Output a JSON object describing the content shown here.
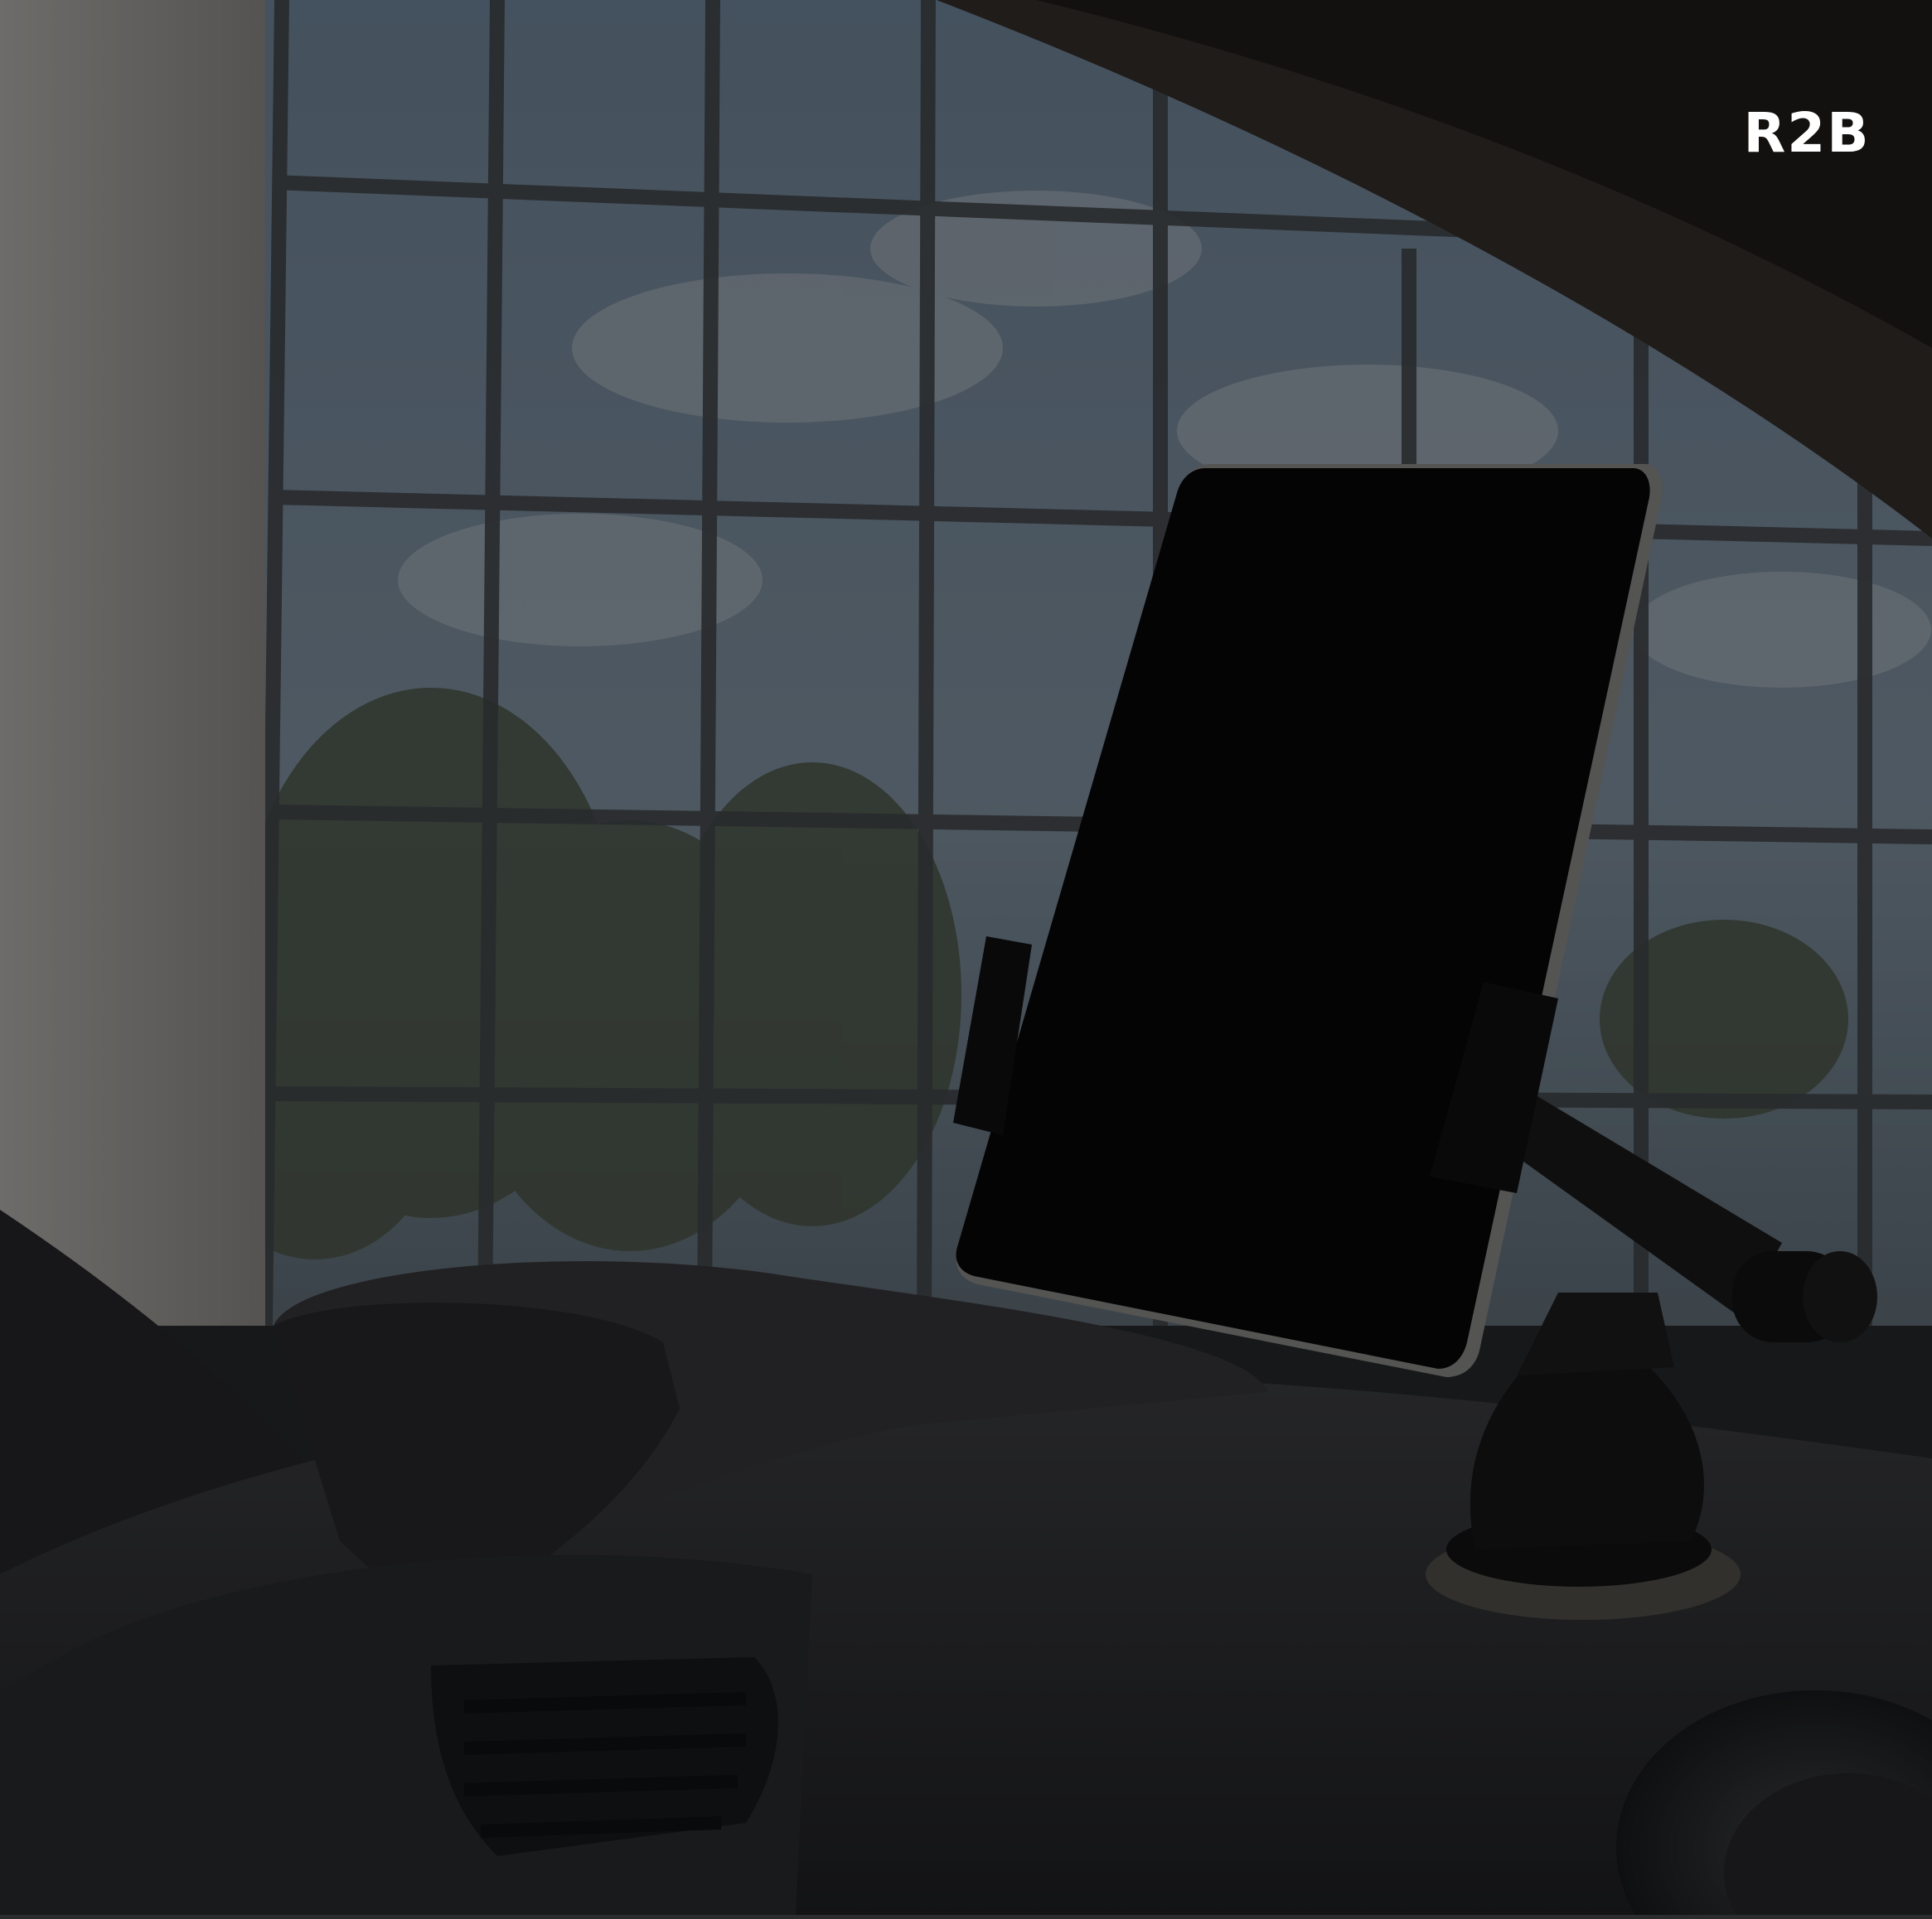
{
  "brand": {
    "logo_text": "R2B"
  },
  "scene": {
    "subject": "tablet-in-car-dashboard-mount",
    "colors": {
      "overlay": "#000000",
      "overlay_opacity": 0.45,
      "sky": "#6f8aa3",
      "window_frame": "#3a3c3e",
      "trees": "#4b5546",
      "dashboard": "#3a3b3d",
      "tablet_bezel": "#0b0b0b",
      "tablet_edge": "#b9b9b9",
      "mount": "#141414",
      "logo": "#ffffff"
    }
  }
}
